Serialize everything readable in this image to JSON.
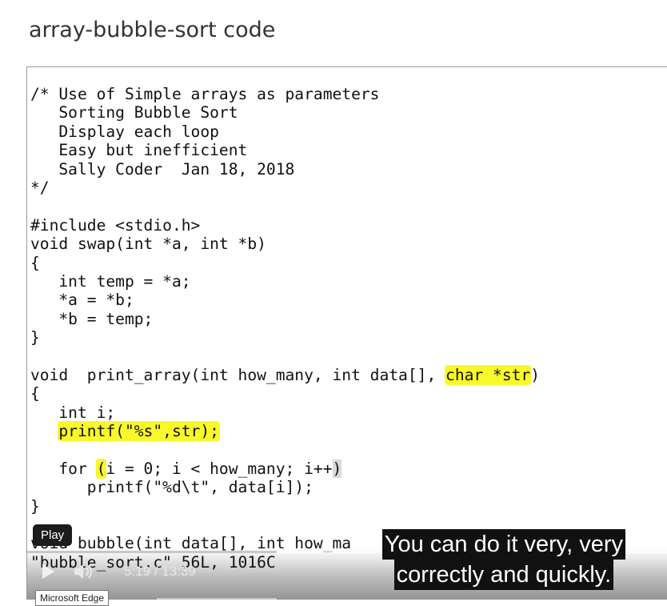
{
  "page": {
    "title": "array-bubble-sort code"
  },
  "code_lines": [
    [
      {
        "t": "/* Use of Simple arrays as parameters"
      }
    ],
    [
      {
        "t": "   Sorting Bubble Sort"
      }
    ],
    [
      {
        "t": "   Display each loop"
      }
    ],
    [
      {
        "t": "   Easy but inefficient"
      }
    ],
    [
      {
        "t": "   Sally Coder  Jan 18, 2018"
      }
    ],
    [
      {
        "t": "*/"
      }
    ],
    [
      {
        "t": ""
      }
    ],
    [
      {
        "t": "#include <stdio.h>"
      }
    ],
    [
      {
        "t": "void swap(int *a, int *b)"
      }
    ],
    [
      {
        "t": "{"
      }
    ],
    [
      {
        "t": "   int temp = *a;"
      }
    ],
    [
      {
        "t": "   *a = *b;"
      }
    ],
    [
      {
        "t": "   *b = temp;"
      }
    ],
    [
      {
        "t": "}"
      }
    ],
    [
      {
        "t": ""
      }
    ],
    [
      {
        "t": "void  print_array(int how_many, int data[], "
      },
      {
        "t": "char *str",
        "hl": true
      },
      {
        "t": ")"
      }
    ],
    [
      {
        "t": "{"
      }
    ],
    [
      {
        "t": "   int i;"
      }
    ],
    [
      {
        "t": "   "
      },
      {
        "t": "printf(\"%s\",str);",
        "hl": true
      }
    ],
    [
      {
        "t": ""
      }
    ],
    [
      {
        "t": "   for "
      },
      {
        "t": "(",
        "hl": true
      },
      {
        "t": "i = 0; i < how_many; i++"
      },
      {
        "t": ")",
        "cur": true
      }
    ],
    [
      {
        "t": "      printf(\"%d\\t\", data[i]);"
      }
    ],
    [
      {
        "t": "}"
      }
    ],
    [
      {
        "t": ""
      }
    ],
    [
      {
        "t": "void bubble(int data[], int how_ma"
      }
    ],
    [
      {
        "t": "\"bubble_sort.c\" 56L, 1016C"
      }
    ]
  ],
  "player": {
    "tooltip": "Play",
    "current_time": "5:19",
    "time_separator": "/",
    "duration": "13:39",
    "progress": 0.39,
    "buffered": 0.0,
    "caption_lines": [
      "You can do it very, very",
      "correctly and quickly."
    ],
    "icons": {
      "play": "play-icon",
      "volume": "volume-icon"
    }
  },
  "app_tooltip": {
    "label": "Microsoft Edge"
  },
  "colors": {
    "highlight": "#f8f82a",
    "caption_bg": "#111111",
    "caption_text": "#ffffff",
    "title_text": "#333333"
  }
}
